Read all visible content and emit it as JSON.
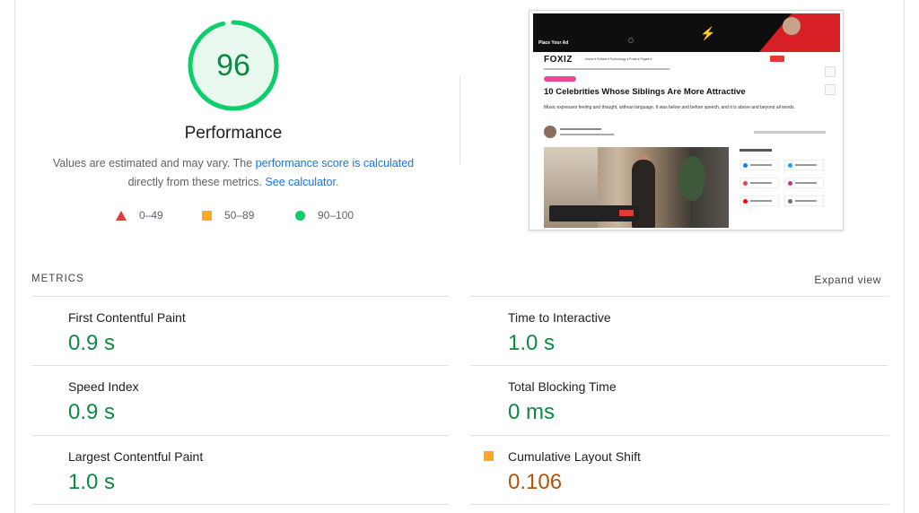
{
  "gauge": {
    "score": "96",
    "fraction": 0.96,
    "color": "#0cce6b"
  },
  "performance": {
    "title": "Performance",
    "desc_prefix": "Values are estimated and may vary. The ",
    "desc_link1": "performance score is calculated",
    "desc_mid": "directly from these metrics. ",
    "desc_link2": "See calculator",
    "desc_end": "."
  },
  "legend": [
    {
      "shape": "triangle",
      "label": "0–49",
      "color": "#e53935"
    },
    {
      "shape": "square",
      "label": "50–89",
      "color": "#ffa726"
    },
    {
      "shape": "circle",
      "label": "90–100",
      "color": "#0cce6b"
    }
  ],
  "thumbnail": {
    "ad_text": "Place Your Ad",
    "logo": "FOXIZ",
    "nav_menu": "Home ▾   Politics ▾   Technology ▾   Posts ▾   Pages ▾",
    "article_title": "10 Celebrities Whose Siblings Are More Attractive",
    "article_desc": "Music expresses feeling and thought, without language. It was below and before speech, and it is above and beyond all words."
  },
  "metrics": {
    "header": "METRICS",
    "expand_label": "Expand view",
    "items": [
      {
        "name": "First Contentful Paint",
        "value": "0.9 s",
        "rating": "good"
      },
      {
        "name": "Time to Interactive",
        "value": "1.0 s",
        "rating": "good"
      },
      {
        "name": "Speed Index",
        "value": "0.9 s",
        "rating": "good"
      },
      {
        "name": "Total Blocking Time",
        "value": "0 ms",
        "rating": "good"
      },
      {
        "name": "Largest Contentful Paint",
        "value": "1.0 s",
        "rating": "good"
      },
      {
        "name": "Cumulative Layout Shift",
        "value": "0.106",
        "rating": "average"
      }
    ]
  },
  "colors": {
    "good": "#0cce6b",
    "good_text": "#0b8a43",
    "average": "#ffa726",
    "poor": "#e53935",
    "link": "#1a73e8"
  }
}
